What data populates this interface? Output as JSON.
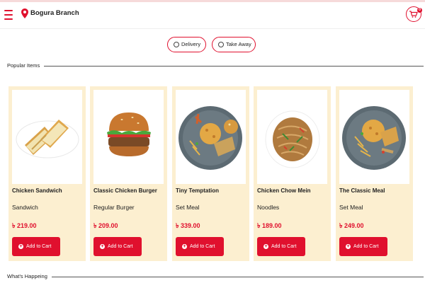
{
  "header": {
    "branch_name": "Bogura Branch",
    "cart_count": "0",
    "brand_color": "#e0102e",
    "icons": [
      "menu-icon",
      "location-pin-icon",
      "shopping-cart-icon"
    ]
  },
  "order_type": {
    "options": [
      {
        "label": "Delivery",
        "selected": false
      },
      {
        "label": "Take Away",
        "selected": false
      }
    ]
  },
  "sections": {
    "popular_title": "Popular Items",
    "whats_happening_title": "What's Happeing"
  },
  "products": [
    {
      "name": "Chicken Sandwich",
      "category": "Sandwich",
      "price": "৳ 219.00",
      "button": "Add to Cart"
    },
    {
      "name": "Classic Chicken Burger",
      "category": "Regular Burger",
      "price": "৳ 209.00",
      "button": "Add to Cart"
    },
    {
      "name": "Tiny Temptation",
      "category": "Set Meal",
      "price": "৳ 339.00",
      "button": "Add to Cart"
    },
    {
      "name": "Chicken Chow Mein",
      "category": "Noodles",
      "price": "৳ 189.00",
      "button": "Add to Cart"
    },
    {
      "name": "The Classic Meal",
      "category": "Set Meal",
      "price": "৳ 249.00",
      "button": "Add to Cart"
    }
  ],
  "colors": {
    "card_background": "#fcefd0",
    "price": "#e0102e",
    "button": "#e0102e"
  }
}
